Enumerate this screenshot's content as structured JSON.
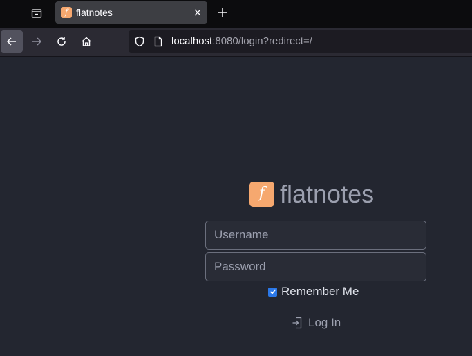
{
  "browser": {
    "tab": {
      "title": "flatnotes",
      "favicon_letter": "f"
    },
    "url": {
      "host": "localhost",
      "rest": ":8080/login?redirect=/"
    },
    "icons": {
      "tab_list": "tab-list-icon",
      "close": "close-icon",
      "new_tab": "plus-icon",
      "back": "back-arrow-icon",
      "forward": "forward-arrow-icon",
      "reload": "reload-icon",
      "home": "home-icon",
      "shield": "shield-icon",
      "page": "page-icon"
    }
  },
  "login": {
    "logo_letter": "f",
    "logo_text": "flatnotes",
    "username_placeholder": "Username",
    "password_placeholder": "Password",
    "remember_label": "Remember Me",
    "remember_checked": true,
    "login_label": "Log In"
  },
  "colors": {
    "page_background": "#232630",
    "brand_orange": "#f6a86f",
    "checkbox_blue": "#2b78e8",
    "muted_text": "#9b9fae"
  }
}
